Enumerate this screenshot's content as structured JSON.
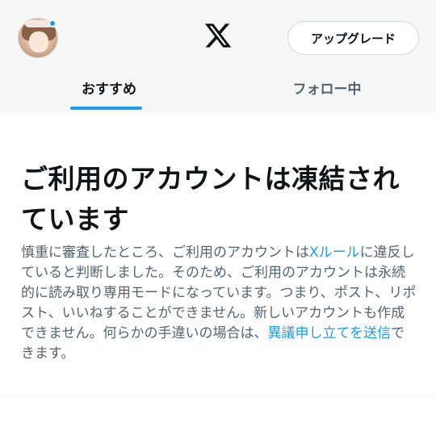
{
  "header": {
    "upgrade_label": "アップグレード",
    "logo_icon": "x-logo-icon",
    "avatar_icon": "user-avatar",
    "notification_dot_color": "#1d9bf0"
  },
  "tabs": [
    {
      "label": "おすすめ",
      "active": true
    },
    {
      "label": "フォロー中",
      "active": false
    }
  ],
  "notice": {
    "title": "ご利用のアカウントは凍結されています",
    "text_1": "慎重に審査したところ、ご利用のアカウントは",
    "link_rules": "Xルール",
    "text_2": "に違反していると判断しました。そのため、ご利用のアカウントは永続的に読み取り専用モードになっています。つまり、ポスト、リポスト、いいねすることができません。新しいアカウントも作成できません。何らかの手違いの場合は、",
    "link_appeal": "異議申し立てを送信",
    "text_3": "できます。"
  },
  "colors": {
    "accent": "#1d9bf0",
    "text_primary": "#0f1419",
    "text_secondary": "#536471"
  }
}
